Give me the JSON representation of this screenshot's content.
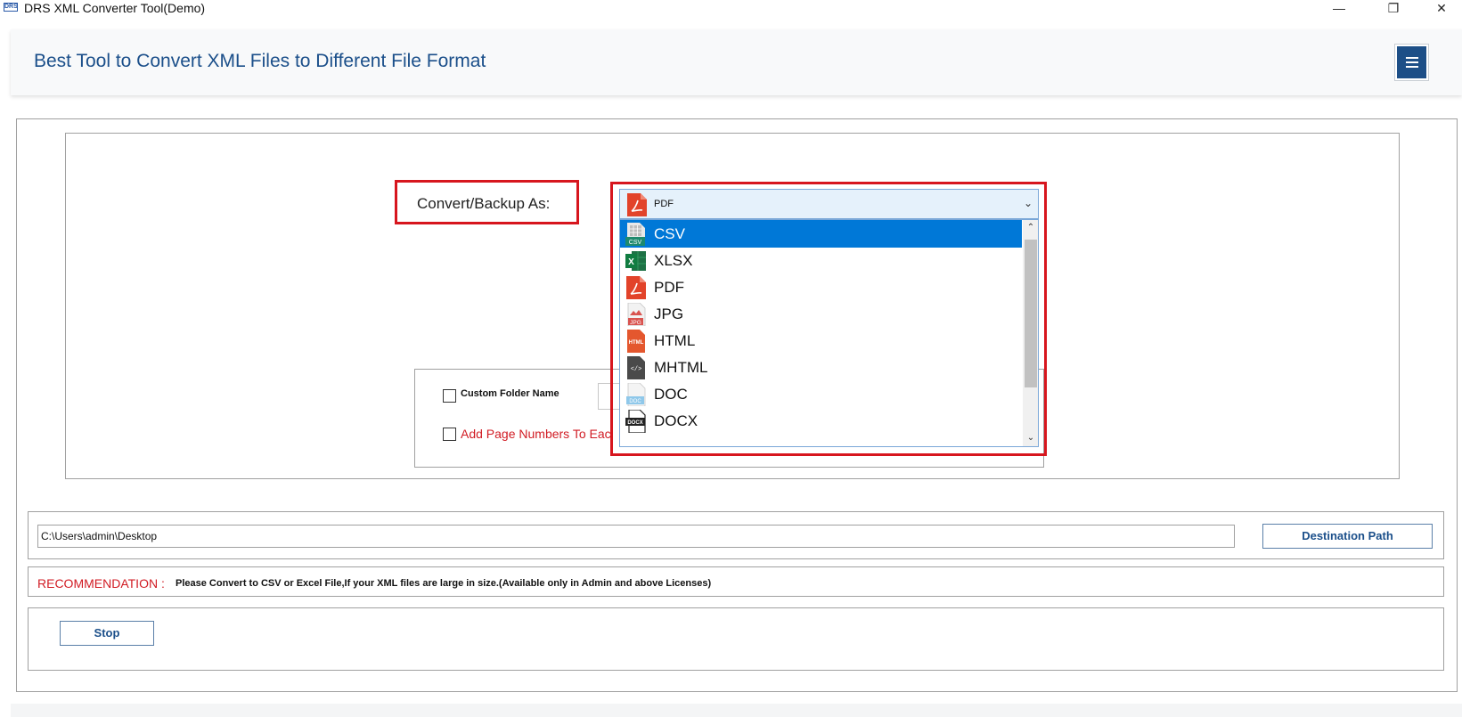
{
  "window": {
    "logo_text": "DRS",
    "title": "DRS XML Converter Tool(Demo)",
    "minimize": "—",
    "restore": "❐",
    "close": "✕"
  },
  "header": {
    "title": "Best Tool to Convert XML Files to Different File Format",
    "menu_icon": "hamburger-icon"
  },
  "convert": {
    "label": "Convert/Backup As:",
    "selected_value": "PDF",
    "options": [
      {
        "label": "CSV",
        "icon": "csv-icon",
        "selected": true
      },
      {
        "label": "XLSX",
        "icon": "xlsx-icon",
        "selected": false
      },
      {
        "label": "PDF",
        "icon": "pdf-icon",
        "selected": false
      },
      {
        "label": "JPG",
        "icon": "jpg-icon",
        "selected": false
      },
      {
        "label": "HTML",
        "icon": "html-icon",
        "selected": false
      },
      {
        "label": "MHTML",
        "icon": "mhtml-icon",
        "selected": false
      },
      {
        "label": "DOC",
        "icon": "doc-icon",
        "selected": false
      },
      {
        "label": "DOCX",
        "icon": "docx-icon",
        "selected": false
      }
    ]
  },
  "sub_options": {
    "custom_folder_label": "Custom Folder Name",
    "page_numbers_label": "Add Page Numbers To Eac"
  },
  "destination": {
    "path": "C:\\Users\\admin\\Desktop",
    "button_label": "Destination Path"
  },
  "recommendation": {
    "label": "RECOMMENDATION :",
    "text": "Please Convert to CSV or Excel File,If your XML files are large in size.(Available only in Admin and above Licenses)"
  },
  "actions": {
    "stop_label": "Stop"
  },
  "colors": {
    "accent": "#1d4f87",
    "highlight_red": "#d7161e",
    "selection": "#0078d7",
    "title_blue": "#1b4f8a"
  }
}
